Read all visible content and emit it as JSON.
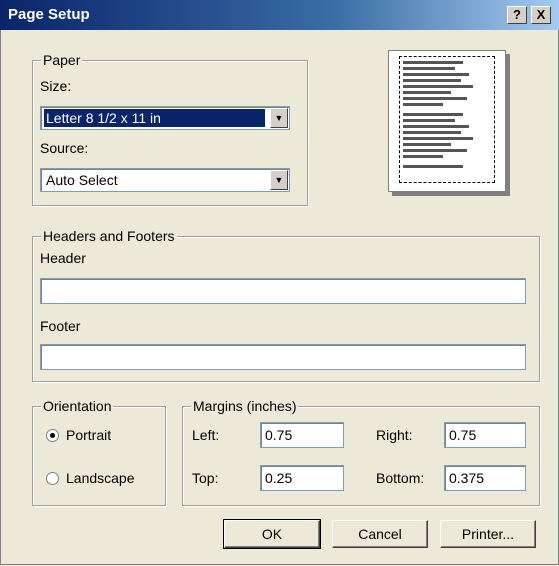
{
  "window": {
    "title": "Page Setup",
    "help_label": "?",
    "close_label": "X"
  },
  "paper": {
    "legend": "Paper",
    "size_label": "Size:",
    "size_value": "Letter 8 1/2 x 11 in",
    "source_label": "Source:",
    "source_value": "Auto Select"
  },
  "headers_footers": {
    "legend": "Headers and Footers",
    "header_label": "Header",
    "header_value": "",
    "footer_label": "Footer",
    "footer_value": ""
  },
  "orientation": {
    "legend": "Orientation",
    "portrait_label": "Portrait",
    "landscape_label": "Landscape",
    "selected": "Portrait"
  },
  "margins": {
    "legend": "Margins (inches)",
    "left_label": "Left:",
    "left_value": "0.75",
    "right_label": "Right:",
    "right_value": "0.75",
    "top_label": "Top:",
    "top_value": "0.25",
    "bottom_label": "Bottom:",
    "bottom_value": "0.375"
  },
  "buttons": {
    "ok": "OK",
    "cancel": "Cancel",
    "printer": "Printer..."
  },
  "colors": {
    "title_bar": "#0A246A",
    "dialog_bg": "#ECE9D8",
    "selection": "#0A246A"
  },
  "icons": {
    "dropdown": "chevron-down-icon",
    "preview": "page-preview-icon"
  }
}
